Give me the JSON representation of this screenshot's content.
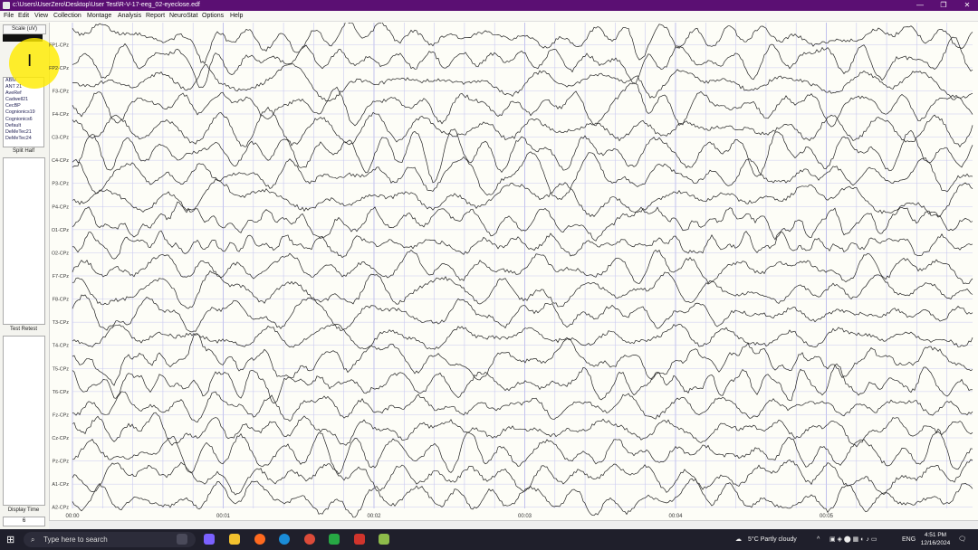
{
  "window": {
    "title": "c:\\Users\\UserZero\\Desktop\\User Test\\R-V-17-eeg_02-eyeclose.edf"
  },
  "menu": [
    "File",
    "Edit",
    "View",
    "Collection",
    "Montage",
    "Analysis",
    "Report",
    "NeuroStat",
    "Options",
    "Help"
  ],
  "sidebar": {
    "scale_label": "Scale (uV)",
    "montages": [
      "ABM",
      "ANT 21",
      "AveRef",
      "Cadwell21",
      "CecBP",
      "Cognionics19",
      "Cognionics6",
      "Default",
      "DeMeTec21",
      "DeMeTec24"
    ],
    "split_half_label": "Split Half",
    "test_retest_label": "Test Retest",
    "display_time_label": "Display Time",
    "display_time_value": "6"
  },
  "channels": [
    "FP1-CPz",
    "FP2-CPz",
    "F3-CPz",
    "F4-CPz",
    "C3-CPz",
    "C4-CPz",
    "P3-CPz",
    "P4-CPz",
    "O1-CPz",
    "O2-CPz",
    "F7-CPz",
    "F8-CPz",
    "T3-CPz",
    "T4-CPz",
    "T5-CPz",
    "T6-CPz",
    "Fz-CPz",
    "Cz-CPz",
    "Pz-CPz",
    "A1-CPz",
    "A2-CPz"
  ],
  "time_labels": [
    "00:00",
    "00:01",
    "00:02",
    "00:03",
    "00:04",
    "00:05"
  ],
  "colors": {
    "trace": "#222222",
    "grid_minor": "#c9c9ef",
    "grid_major": "#9a9ae6",
    "titlebar": "#5b0f73"
  },
  "taskbar": {
    "search_placeholder": "Type here to search",
    "weather": "5°C  Partly cloudy",
    "lang": "ENG",
    "time": "4:51 PM",
    "date": "12/16/2024"
  }
}
